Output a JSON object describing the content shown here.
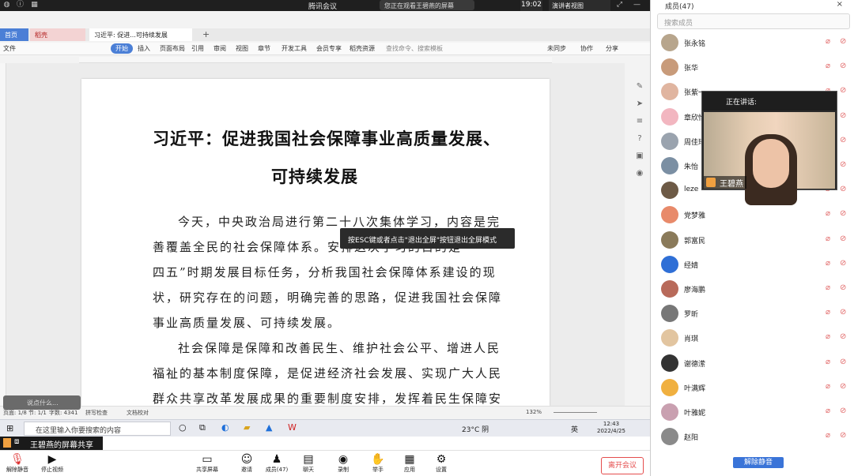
{
  "window": {
    "title": "腾讯会议",
    "viewing_label": "您正在观看王碧燕的屏幕",
    "time": "19:02",
    "speaker_view": "演讲者视图"
  },
  "members_panel": {
    "title": "成员(47)",
    "search_placeholder": "搜索成员",
    "members": [
      {
        "name": "张永铭"
      },
      {
        "name": "张华"
      },
      {
        "name": "张紫一"
      },
      {
        "name": "章欣怡"
      },
      {
        "name": "周佳琦"
      },
      {
        "name": "朱怡"
      },
      {
        "name": "leze"
      },
      {
        "name": "党梦雅"
      },
      {
        "name": "郭富民"
      },
      {
        "name": "经婧"
      },
      {
        "name": "廖海鹏"
      },
      {
        "name": "罗昕"
      },
      {
        "name": "肖琪"
      },
      {
        "name": "谢德潆"
      },
      {
        "name": "叶满辉"
      },
      {
        "name": "叶雅妮"
      },
      {
        "name": "赵阳"
      }
    ],
    "unmute_all": "解除静音"
  },
  "video_tile": {
    "header": "正在讲话:",
    "name": "王碧燕"
  },
  "wps": {
    "tabs": [
      "首页",
      "稻壳",
      "习近平: 促进...可持续发展"
    ],
    "menu": [
      "文件",
      "开始",
      "插入",
      "页面布局",
      "引用",
      "审阅",
      "视图",
      "章节",
      "开发工具",
      "会员专享",
      "稻壳资源",
      "查找命令、搜索模板",
      "未同步",
      "协作",
      "分享"
    ],
    "document": {
      "title_line1": "习近平：促进我国社会保障事业高质量发展、",
      "title_line2": "可持续发展",
      "lines": [
        "今天，中央政治局进行第二十八次集体学习，内容是完",
        "善覆盖全民的社会保障体系。安排这次学习的目的是",
        "四五”时期发展目标任务，分析我国社会保障体系建设的现",
        "状，研究存在的问题，明确完善的思路，促进我国社会保障",
        "事业高质量发展、可持续发展。",
        "社会保障是保障和改善民生、维护社会公平、增进人民",
        "福祉的基本制度保障，是促进经济社会发展、实现广大人民",
        "群众共享改革发展成果的重要制度安排，发挥着民生保障安"
      ]
    },
    "tooltip": "按ESC键或者点击\"退出全屏\"按钮退出全屏模式",
    "status": {
      "page": "页面: 1/8",
      "section": "节: 1/1",
      "words": "字数: 4341",
      "spell": "拼写检查",
      "proof": "文档校对",
      "zoom": "132%"
    },
    "comment_placeholder": "说点什么..."
  },
  "taskbar": {
    "search_placeholder": "在这里输入你要搜索的内容",
    "weather": "23°C 阴",
    "ime": "英",
    "time": "12:43",
    "date": "2022/4/25"
  },
  "share_banner": "王碧燕的屏幕共享",
  "toolbar": {
    "buttons": [
      "解除静音",
      "停止视频",
      "共享屏幕",
      "邀请",
      "成员(47)",
      "聊天",
      "录制",
      "举手",
      "应用",
      "设置"
    ],
    "leave": "离开会议"
  }
}
